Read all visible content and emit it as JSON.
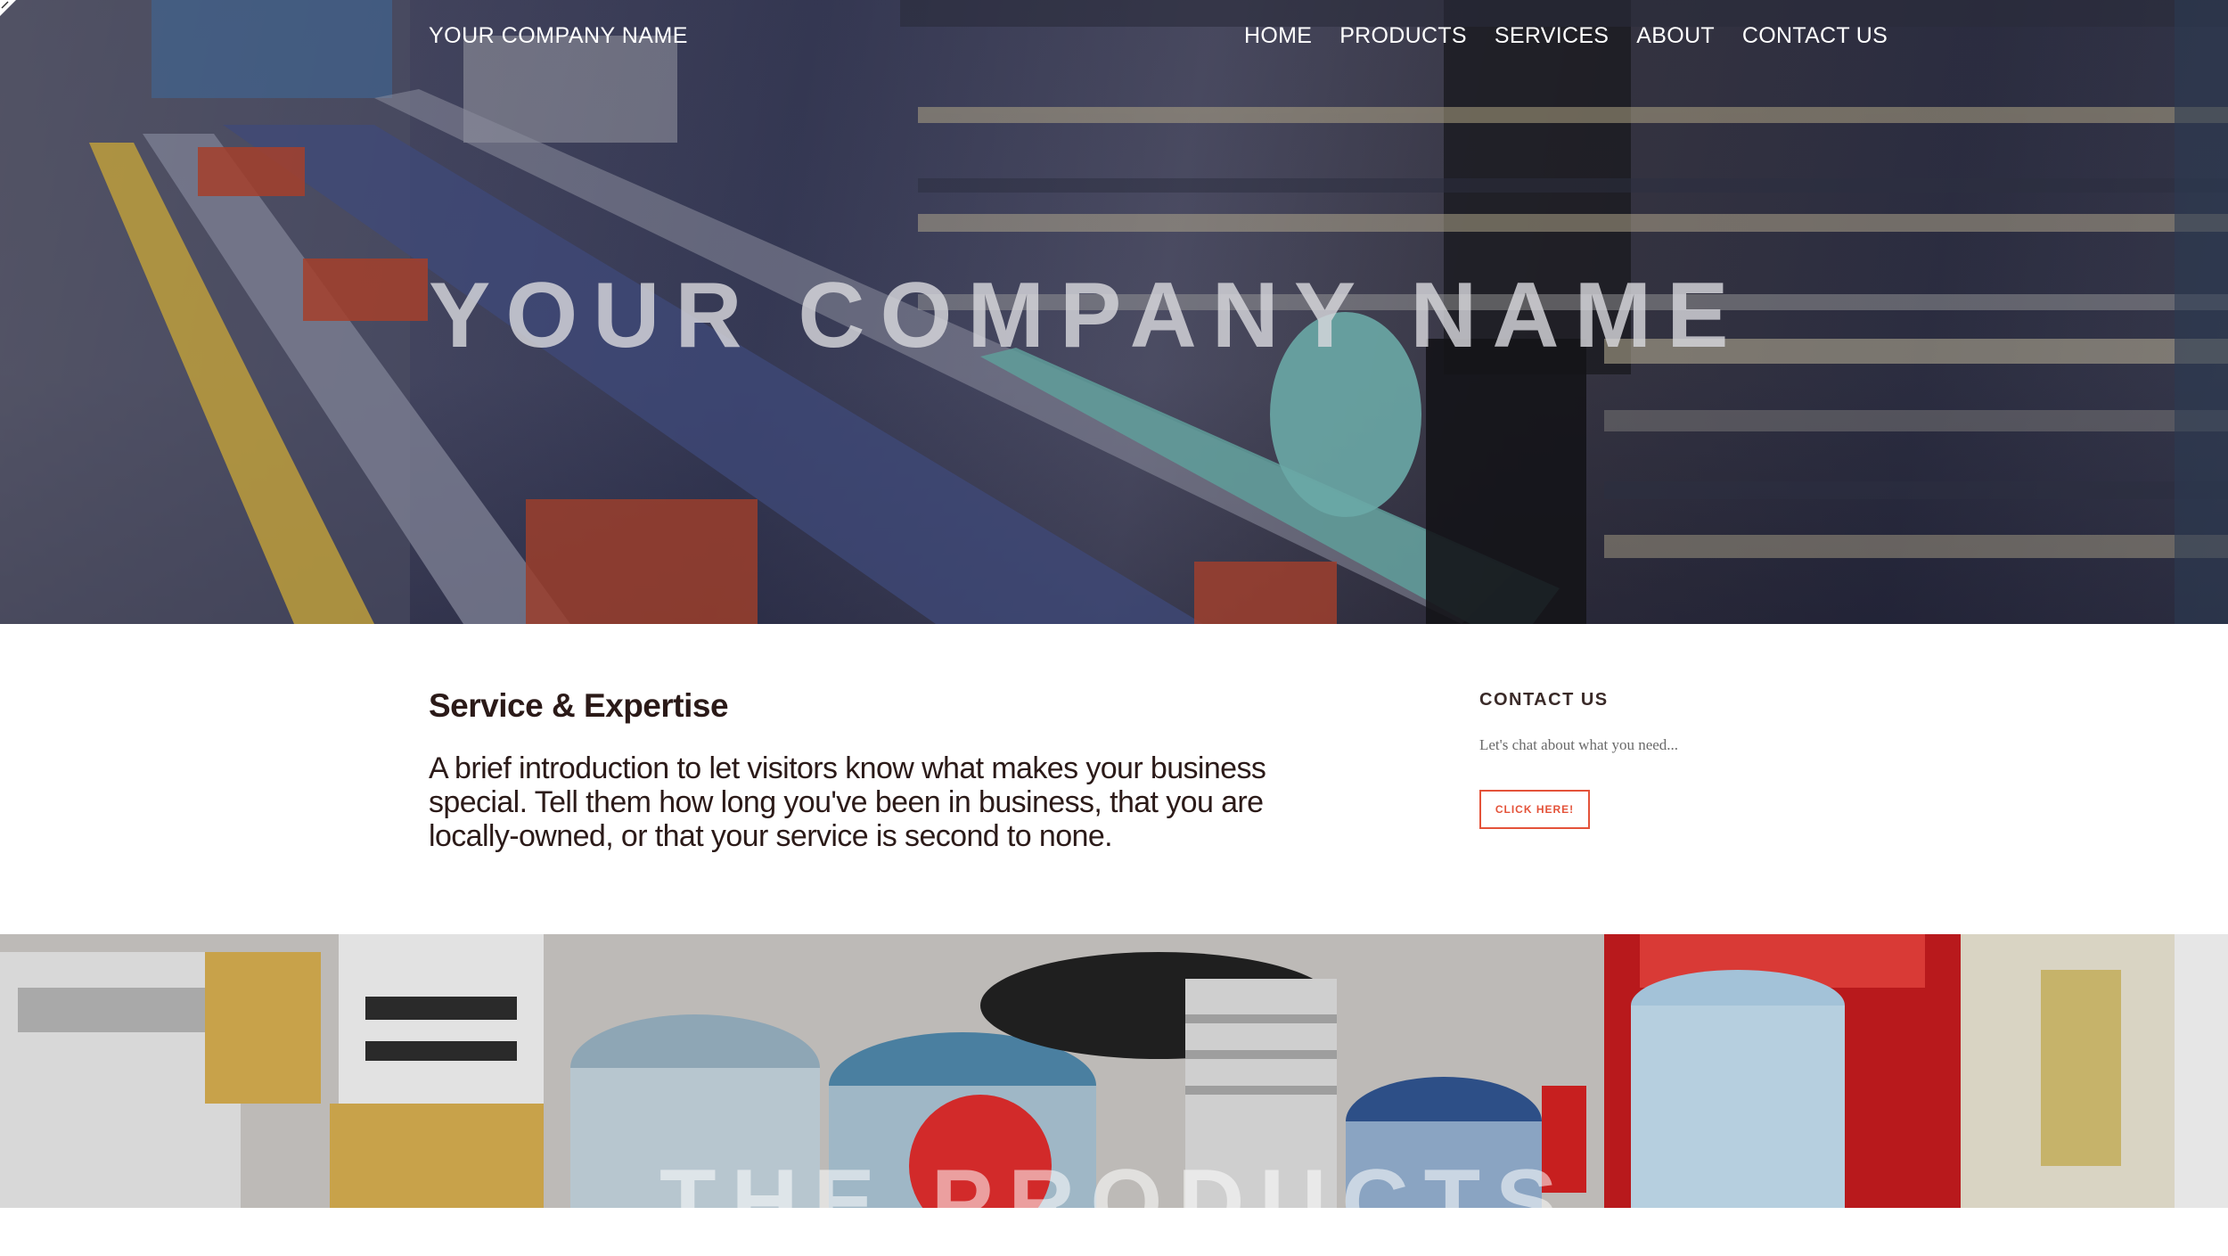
{
  "header": {
    "brand": "YOUR COMPANY NAME",
    "nav": [
      "HOME",
      "PRODUCTS",
      "SERVICES",
      "ABOUT",
      "CONTACT US"
    ]
  },
  "hero": {
    "title": "YOUR COMPANY NAME",
    "image": "factory-pipe-machinery-photo"
  },
  "intro": {
    "heading": "Service & Expertise",
    "body": "A brief introduction to let visitors know what makes your business special. Tell them how long you've been in business, that you are locally-owned, or that your service is second to none."
  },
  "aside": {
    "heading": "CONTACT US",
    "text": "Let's chat about what you need...",
    "button": "CLICK HERE!"
  },
  "products": {
    "title": "THE PRODUCTS",
    "image": "hose-fittings-photo"
  },
  "colors": {
    "accent": "#e4533a",
    "text_dark": "#2b1a18",
    "hero_overlay": "#3b3f5c"
  }
}
